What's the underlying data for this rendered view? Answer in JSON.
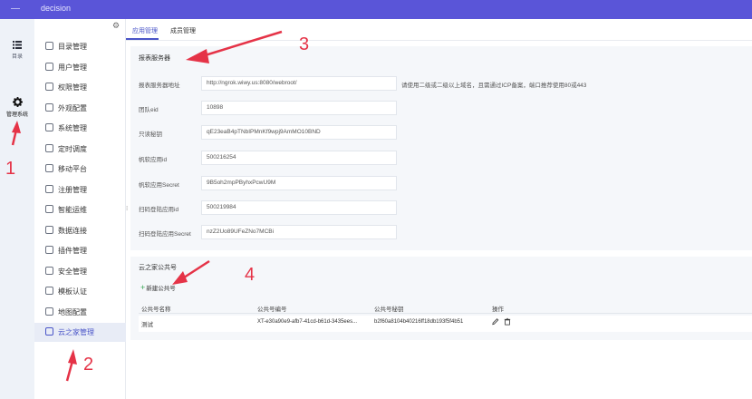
{
  "topbar": {
    "title": "decision"
  },
  "leftnav": {
    "items": [
      {
        "label": "目录",
        "icon": "list-icon"
      },
      {
        "label": "管理系统",
        "icon": "gear-icon"
      }
    ]
  },
  "sidemenu": {
    "items": [
      {
        "label": "目录管理"
      },
      {
        "label": "用户管理"
      },
      {
        "label": "权限管理"
      },
      {
        "label": "外观配置"
      },
      {
        "label": "系统管理"
      },
      {
        "label": "定时调度"
      },
      {
        "label": "移动平台"
      },
      {
        "label": "注册管理"
      },
      {
        "label": "智能运维"
      },
      {
        "label": "数据连接"
      },
      {
        "label": "插件管理"
      },
      {
        "label": "安全管理"
      },
      {
        "label": "模板认证"
      },
      {
        "label": "地图配置"
      },
      {
        "label": "云之家管理"
      }
    ]
  },
  "tabs": [
    {
      "label": "应用管理"
    },
    {
      "label": "成员管理"
    }
  ],
  "report_server": {
    "title": "报表服务器",
    "fields": [
      {
        "label": "报表服务器地址",
        "value": "http://ngrok.wiwy.us:8080/webroot/",
        "hint": "请使用二级或二级以上域名，且需通过ICP备案，端口推荐使用80或443"
      },
      {
        "label": "团队eid",
        "value": "10898"
      },
      {
        "label": "只读秘钥",
        "value": "qE23eaB4pTNbIPMnKf9wpj9AmMO10BND"
      },
      {
        "label": "帆软应用id",
        "value": "500216254"
      },
      {
        "label": "帆软应用Secret",
        "value": "9B5oh2mpPByhxPcwU9M"
      },
      {
        "label": "扫码登陆应用id",
        "value": "500219984"
      },
      {
        "label": "扫码登陆应用Secret",
        "value": "nzZ2Uo89UFeZNo7MCBi"
      }
    ]
  },
  "public_account": {
    "title": "云之家公共号",
    "add_label": "新建公共号",
    "columns": [
      "公共号名称",
      "公共号编号",
      "公共号秘钥",
      "操作"
    ],
    "rows": [
      {
        "name": "测试",
        "number": "XT-e30a90e9-afb7-41cd-b61d-3435ees...",
        "secret": "b2f60a8104b40216ff18db193f5f4b51"
      }
    ]
  },
  "annotations": {
    "n1": "1",
    "n2": "2",
    "n3": "3",
    "n4": "4"
  },
  "colors": {
    "topbar": "#5a55d8",
    "accent": "#4a55c8",
    "annotation": "#e53347",
    "add": "#3aa655"
  }
}
